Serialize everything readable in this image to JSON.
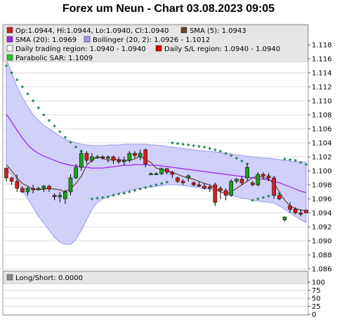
{
  "title": "Forex um Neun - Chart 03.08.2023 09:05",
  "legend": [
    {
      "swatch": "#cc2222",
      "text": "Op:1.0944, Hi:1.0944, Lo:1.0940, Cl:1.0940"
    },
    {
      "swatch": "#6b4226",
      "text": "SMA (5): 1.0943"
    },
    {
      "swatch": "#a020f0",
      "text": "SMA (20): 1.0969"
    },
    {
      "swatch": "#9999ee",
      "text": "Bollinger (20, 2): 1.0926 - 1.1012"
    },
    {
      "swatch": "#ffffff",
      "text": "Daily trading region: 1.0940 - 1.0940"
    },
    {
      "swatch": "#dd0000",
      "text": "Daily S/L region: 1.0940 - 1.0940"
    },
    {
      "swatch": "#22cc22",
      "text": "Parabolic SAR: 1.1009"
    }
  ],
  "sub_legend": {
    "swatch": "#888888",
    "text": "Long/Short: 0.0000"
  },
  "chart_data": {
    "type": "candlestick",
    "title": "Forex um Neun - Chart 03.08.2023 09:05",
    "ylim": [
      1.086,
      1.118
    ],
    "y_ticks": [
      "1.118",
      "1.116",
      "1.114",
      "1.112",
      "1.110",
      "1.108",
      "1.106",
      "1.104",
      "1.102",
      "1.100",
      "1.098",
      "1.096",
      "1.094",
      "1.092",
      "1.090",
      "1.088",
      "1.086"
    ],
    "grid": true,
    "candles": [
      [
        1.1004,
        1.1004,
        1.0985,
        1.099
      ],
      [
        1.099,
        1.0992,
        1.098,
        1.0985
      ],
      [
        1.0985,
        1.0995,
        1.097,
        1.0975
      ],
      [
        1.0975,
        1.0978,
        1.0968,
        1.097
      ],
      [
        1.097,
        1.0978,
        1.0965,
        1.0975
      ],
      [
        1.0975,
        1.098,
        1.0968,
        1.0973
      ],
      [
        1.0973,
        1.0977,
        1.0972,
        1.0975
      ],
      [
        1.0975,
        1.098,
        1.097,
        1.0978
      ],
      [
        1.0978,
        1.098,
        1.097,
        1.0974
      ],
      [
        1.0965,
        1.0968,
        1.0958,
        1.0963
      ],
      [
        1.0963,
        1.097,
        1.0955,
        1.0965
      ],
      [
        1.096,
        1.0973,
        1.0953,
        1.097
      ],
      [
        1.097,
        1.0995,
        1.0965,
        1.099
      ],
      [
        1.099,
        1.101,
        1.0988,
        1.1005
      ],
      [
        1.1005,
        1.103,
        1.1,
        1.1025
      ],
      [
        1.1025,
        1.1028,
        1.101,
        1.1015
      ],
      [
        1.1015,
        1.1025,
        1.1012,
        1.102
      ],
      [
        1.102,
        1.1023,
        1.1017,
        1.102
      ],
      [
        1.102,
        1.1022,
        1.1016,
        1.1018
      ],
      [
        1.1018,
        1.1022,
        1.1012,
        1.102
      ],
      [
        1.102,
        1.1022,
        1.101,
        1.1015
      ],
      [
        1.1015,
        1.102,
        1.101,
        1.1013
      ],
      [
        1.1013,
        1.102,
        1.1008,
        1.1015
      ],
      [
        1.1015,
        1.1028,
        1.1012,
        1.1025
      ],
      [
        1.1025,
        1.1028,
        1.1018,
        1.1022
      ],
      [
        1.102,
        1.103,
        1.1015,
        1.1025
      ],
      [
        1.103,
        1.1032,
        1.1005,
        1.101
      ],
      [
        1.0996,
        1.0998,
        1.0994,
        1.0996
      ],
      [
        1.0996,
        1.0998,
        1.0994,
        1.0996
      ],
      [
        1.0996,
        1.1005,
        1.0994,
        1.1003
      ],
      [
        1.1003,
        1.1004,
        1.0995,
        1.0998
      ],
      [
        1.0998,
        1.1,
        1.099,
        1.0995
      ],
      [
        1.099,
        1.0992,
        1.0983,
        1.0985
      ],
      [
        1.0985,
        1.0988,
        1.098,
        1.0983
      ],
      [
        1.099,
        1.0995,
        1.0985,
        1.0993
      ],
      [
        1.0983,
        1.0985,
        1.0978,
        1.098
      ],
      [
        1.098,
        1.0985,
        1.0977,
        1.0978
      ],
      [
        1.0978,
        1.0982,
        1.0973,
        1.0975
      ],
      [
        1.0977,
        1.098,
        1.097,
        1.0975
      ],
      [
        1.098,
        1.0983,
        1.095,
        1.0955
      ],
      [
        1.0975,
        1.0978,
        1.096,
        1.0972
      ],
      [
        1.0972,
        1.0975,
        1.0958,
        1.0965
      ],
      [
        1.0965,
        1.0988,
        1.0963,
        1.0985
      ],
      [
        1.0985,
        1.099,
        1.0982,
        1.0988
      ],
      [
        1.0988,
        1.0992,
        1.098,
        1.0983
      ],
      [
        1.099,
        1.101,
        1.0985,
        1.1005
      ],
      [
        1.0983,
        1.0985,
        1.0978,
        1.098
      ],
      [
        1.098,
        1.0998,
        1.0978,
        1.0995
      ],
      [
        1.0995,
        1.0998,
        1.0988,
        1.0993
      ],
      [
        1.0993,
        1.0997,
        1.0985,
        1.099
      ],
      [
        1.099,
        1.0993,
        1.096,
        1.0965
      ],
      [
        1.0965,
        1.0968,
        1.0958,
        1.096
      ],
      [
        1.093,
        1.0935,
        1.0928,
        1.0934
      ],
      [
        1.095,
        1.0955,
        1.094,
        1.0945
      ],
      [
        1.0945,
        1.0948,
        1.0938,
        1.094
      ],
      [
        1.094,
        1.0945,
        1.0935,
        1.0938
      ],
      [
        1.0944,
        1.0944,
        1.094,
        1.094
      ]
    ],
    "series": [
      {
        "name": "SMA (5)",
        "values": [
          1.1009,
          1.1,
          1.099,
          1.0982,
          1.0978,
          1.0974,
          1.0973,
          1.0974,
          1.0975,
          1.0974,
          1.0973,
          1.097,
          1.0975,
          1.0982,
          1.0992,
          1.1008,
          1.1015,
          1.102,
          1.1018,
          1.1015,
          1.1017,
          1.1016,
          1.1015,
          1.1015,
          1.1017,
          1.1021,
          1.1016,
          1.1012,
          1.1004,
          1.1002,
          1.1,
          1.0998,
          1.0995,
          1.0992,
          1.099,
          1.0988,
          1.0985,
          1.0982,
          1.098,
          1.0975,
          1.097,
          1.0967,
          1.097,
          1.0975,
          1.098,
          1.0985,
          1.099,
          1.0993,
          1.0991,
          1.0988,
          1.0982,
          1.097,
          1.0958,
          1.095,
          1.0946,
          1.0944,
          1.0943
        ]
      },
      {
        "name": "SMA (20)",
        "values": [
          1.1081,
          1.107,
          1.1058,
          1.1047,
          1.1037,
          1.103,
          1.1025,
          1.1021,
          1.1018,
          1.1015,
          1.1012,
          1.101,
          1.1008,
          1.1007,
          1.1006,
          1.1005,
          1.1004,
          1.1004,
          1.1004,
          1.1005,
          1.1006,
          1.1007,
          1.1008,
          1.1008,
          1.1009,
          1.1009,
          1.1009,
          1.1008,
          1.1008,
          1.1007,
          1.1006,
          1.1005,
          1.1004,
          1.1003,
          1.1002,
          1.1001,
          1.1,
          1.0999,
          1.0998,
          1.0997,
          1.0996,
          1.0995,
          1.0994,
          1.0993,
          1.0992,
          1.0991,
          1.099,
          1.0989,
          1.0988,
          1.0987,
          1.0985,
          1.0983,
          1.098,
          1.0977,
          1.0974,
          1.0971,
          1.0969
        ]
      }
    ],
    "bollinger_upper": [
      1.116,
      1.114,
      1.112,
      1.1105,
      1.1092,
      1.108,
      1.1072,
      1.1065,
      1.106,
      1.1055,
      1.105,
      1.1045,
      1.1042,
      1.104,
      1.1038,
      1.1037,
      1.1036,
      1.1036,
      1.1036,
      1.1037,
      1.1037,
      1.1037,
      1.1038,
      1.1038,
      1.1038,
      1.1038,
      1.1038,
      1.1037,
      1.1037,
      1.1036,
      1.1035,
      1.1034,
      1.1033,
      1.1032,
      1.1031,
      1.103,
      1.1029,
      1.1028,
      1.1028,
      1.1027,
      1.1026,
      1.1025,
      1.1024,
      1.1023,
      1.1022,
      1.1021,
      1.102,
      1.1019,
      1.1018,
      1.1018,
      1.1017,
      1.1016,
      1.1015,
      1.1014,
      1.1013,
      1.1013,
      1.1012
    ],
    "bollinger_lower": [
      1.1,
      1.0995,
      1.0985,
      1.0972,
      1.096,
      1.0948,
      1.0935,
      1.0925,
      1.0915,
      1.0905,
      1.0898,
      1.0895,
      1.0895,
      1.0902,
      1.0915,
      1.093,
      1.0945,
      1.0955,
      1.096,
      1.0963,
      1.0966,
      1.0968,
      1.097,
      1.0972,
      1.0974,
      1.0975,
      1.0976,
      1.0977,
      1.0978,
      1.0979,
      1.098,
      1.098,
      1.098,
      1.0979,
      1.0978,
      1.0977,
      1.0976,
      1.0975,
      1.0974,
      1.0972,
      1.097,
      1.0967,
      1.0965,
      1.0963,
      1.0961,
      1.096,
      1.0958,
      1.0957,
      1.0956,
      1.0955,
      1.0954,
      1.095,
      1.0945,
      1.094,
      1.0935,
      1.093,
      1.0926
    ],
    "sar": [
      1.115,
      1.114,
      1.113,
      1.112,
      1.111,
      1.11,
      1.109,
      1.108,
      1.1072,
      1.1064,
      1.1056,
      1.1048,
      1.1041,
      1.1034,
      1.1028,
      null,
      1.096,
      1.0961,
      1.0962,
      1.0963,
      1.0965,
      1.0967,
      1.0968,
      1.097,
      1.0972,
      1.0974,
      1.0976,
      1.0978,
      1.098,
      1.0982,
      1.0984,
      1.104,
      1.1039,
      1.1038,
      1.1037,
      1.1036,
      1.1035,
      1.1034,
      1.1032,
      1.103,
      1.1028,
      1.1025,
      1.1022,
      1.1018,
      1.1014,
      1.101,
      1.0958,
      1.096,
      1.0962,
      1.0964,
      1.0966,
      1.0968,
      1.1017,
      1.1016,
      1.1015,
      1.1012,
      1.1009
    ],
    "sub_chart": {
      "series": "Long/Short",
      "value": 0,
      "ylim": [
        0,
        100
      ],
      "y_ticks": [
        "100",
        "75",
        "50",
        "25",
        "0"
      ]
    }
  }
}
